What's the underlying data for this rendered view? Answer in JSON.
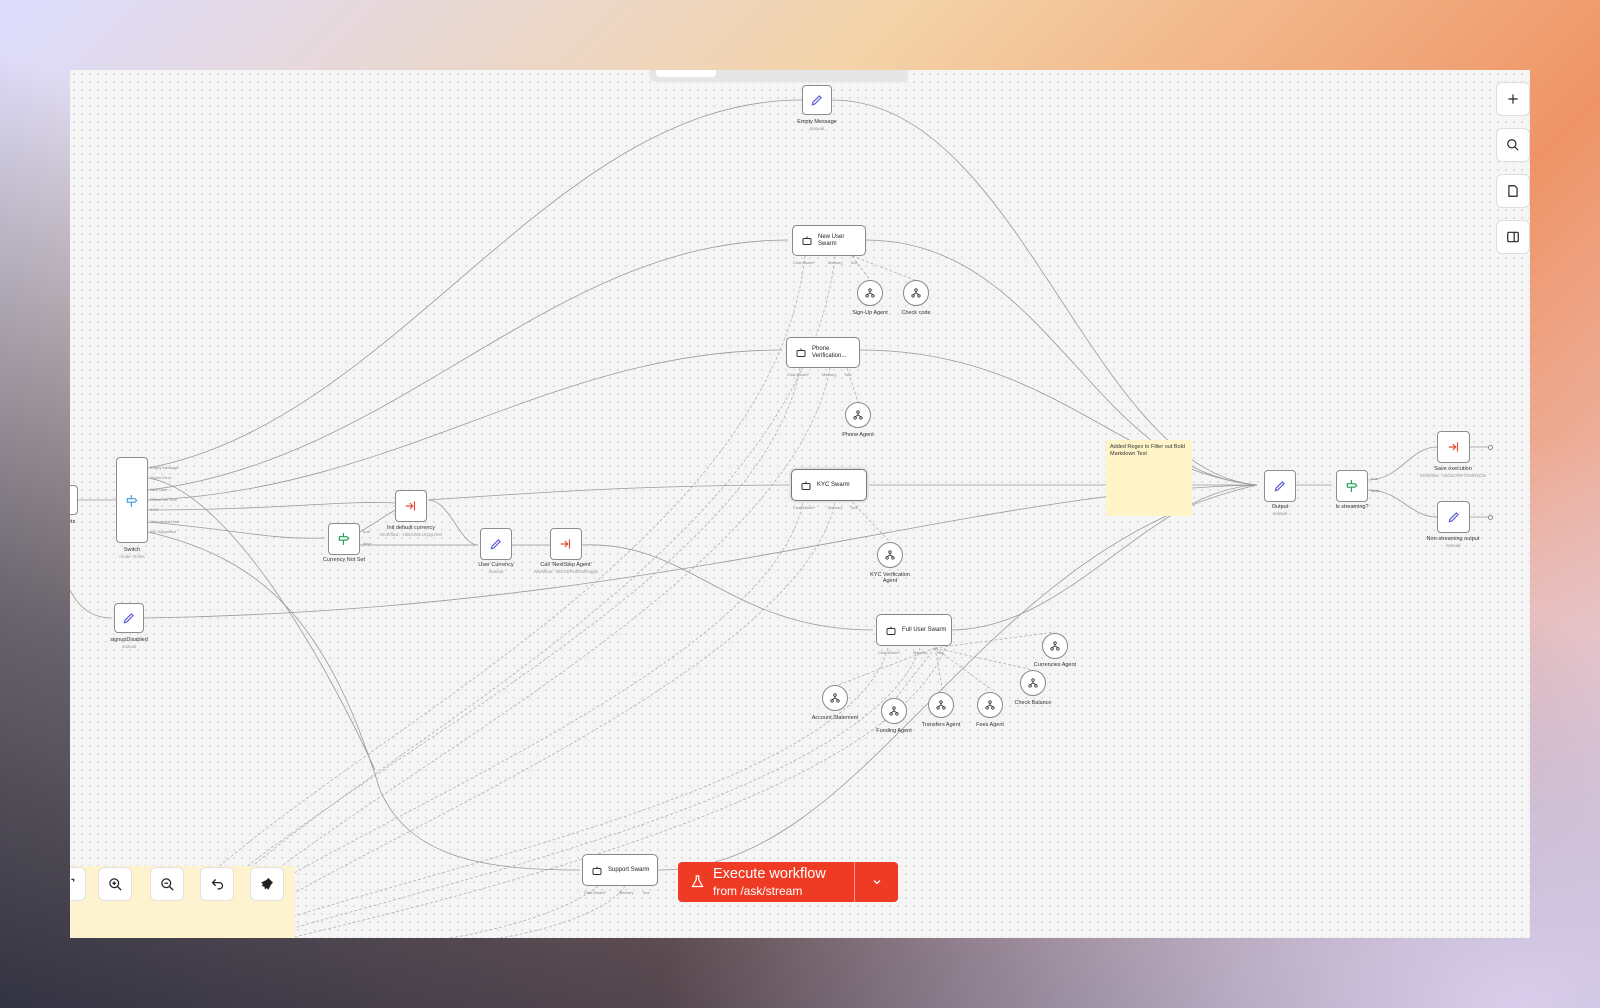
{
  "canvas": {
    "nodes": {
      "empty_message": {
        "label": "Empty Message",
        "sub": "manual"
      },
      "switch": {
        "label": "Switch",
        "sub": "mode: Rules",
        "outputs": [
          "Empty Message",
          "Signin Error",
          "New User",
          "Phone Ver Run",
          "KYC",
          "Onboarded User",
          "Not Supported"
        ]
      },
      "left_partial": {
        "label": "ets"
      },
      "init_currency": {
        "label": "Init default currency",
        "sub": "Workflow: ·c0B4JWLUGpyzXel"
      },
      "currency_not_set": {
        "label": "Currency Not Set",
        "out_true": "true",
        "out_false": "false"
      },
      "user_currency": {
        "label": "User Currency",
        "sub": "manual"
      },
      "call_nextstep": {
        "label": "Call 'NextStep Agent'",
        "sub": "Workflow: ·BkcXEPcdFtahHqgm"
      },
      "signup_disabled": {
        "label": "signupDisabled",
        "sub": "manual"
      },
      "output": {
        "label": "Output",
        "sub": "manual"
      },
      "is_streaming": {
        "label": "Is streaming?",
        "out_true": "true",
        "out_false": "false"
      },
      "save_execution": {
        "label": "Save execution",
        "sub": "Workflow: ·u0GarXRFzXMHXCte"
      },
      "non_streaming_output": {
        "label": "Non-streaming output",
        "sub": "manual"
      }
    },
    "agents": {
      "new_user": {
        "title": "New User Swarm"
      },
      "phone": {
        "title": "Phone Verification..."
      },
      "kyc": {
        "title": "KYC Swarm"
      },
      "full_user": {
        "title": "Full User Swarm"
      },
      "support": {
        "title": "Support Swarm"
      }
    },
    "agent_ports": {
      "model": "Chat Model*",
      "memory": "Memory",
      "tool": "Tool"
    },
    "tools": {
      "signup_agent": "Sign-Up Agent",
      "check_code": "Check code",
      "phone_agent": "Phone Agent",
      "kyc_agent": "KYC Verification Agent",
      "currencies_agent": "Currencies Agent",
      "check_balance": "Check Balance",
      "account_statement": "Account Statement",
      "funding_agent": "Funding Agent",
      "transfers_agent": "Transfers Agent",
      "fees_agent": "Fees Agent"
    },
    "sticky_note": "Added Regex to Filter out Bold Markdown Text"
  },
  "right_toolbar": {
    "add": "plus-icon",
    "search": "search-icon",
    "note": "sticky-note-icon",
    "panel": "panel-icon"
  },
  "bottom_controls": {
    "fit": "fit-icon",
    "zoom_in": "zoom-in-icon",
    "zoom_out": "zoom-out-icon",
    "undo": "undo-icon",
    "clean": "broom-icon"
  },
  "execute": {
    "label": "Execute workflow",
    "sub": "from /ask/stream"
  },
  "colors": {
    "accent": "#ef3b24",
    "sticky": "#fff4c8",
    "pen": "#5b5bd6",
    "switch": "#1f9f5a",
    "exec_node": "#e8493a"
  }
}
